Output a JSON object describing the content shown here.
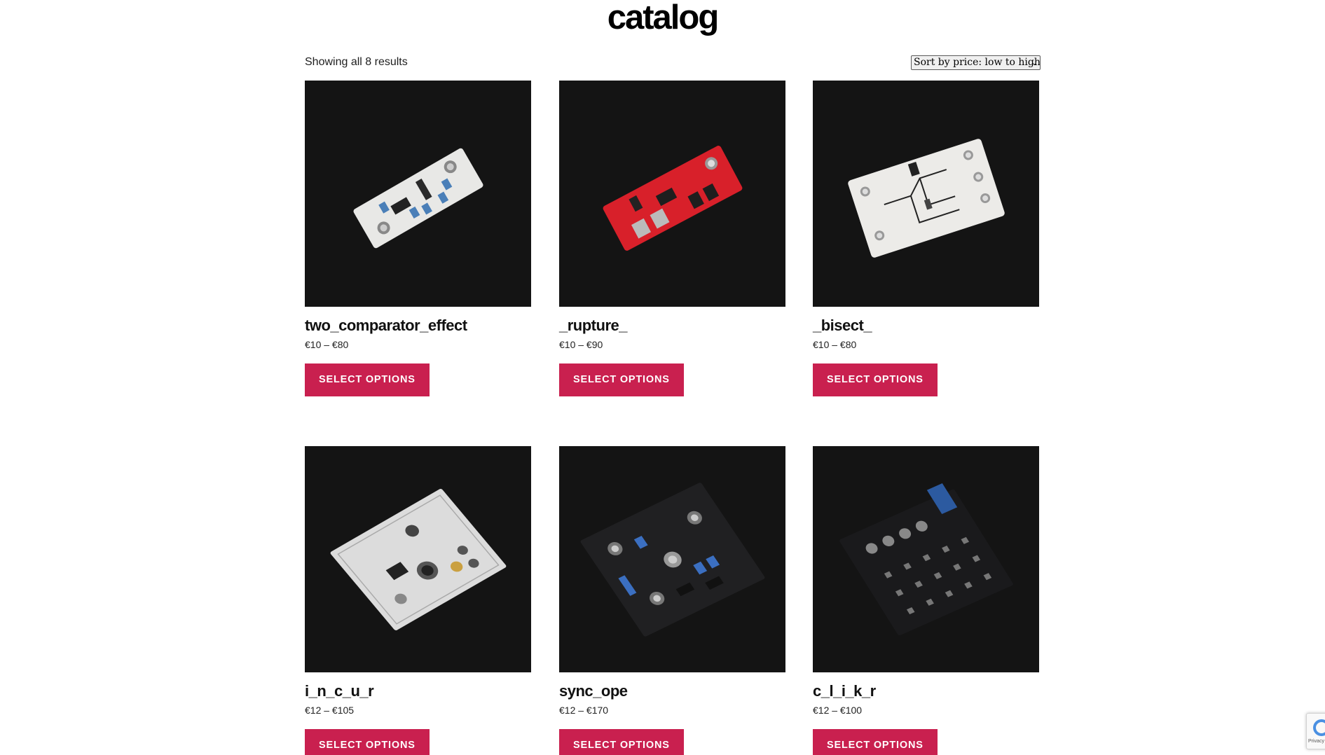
{
  "page": {
    "title": "catalog"
  },
  "results": {
    "count_text": "Showing all 8 results"
  },
  "sort": {
    "selected": "Sort by price: low to high"
  },
  "products": [
    {
      "name": "two_comparator_effect",
      "price": "€10 – €80",
      "button": "Select options",
      "board_color": "#e8e8e6"
    },
    {
      "name": "_rupture_",
      "price": "€10 – €90",
      "button": "Select options",
      "board_color": "#d8202a"
    },
    {
      "name": "_bisect_",
      "price": "€10 – €80",
      "button": "Select options",
      "board_color": "#ecebe8"
    },
    {
      "name": "i_n_c_u_r",
      "price": "€12 – €105",
      "button": "Select options",
      "board_color": "#dcdcdc"
    },
    {
      "name": "sync_ope",
      "price": "€12 – €170",
      "button": "Select options",
      "board_color": "#202022"
    },
    {
      "name": "c_l_i_k_r",
      "price": "€12 – €100",
      "button": "Select options",
      "board_color": "#1a1a1c"
    }
  ],
  "recaptcha": {
    "label": "Privacy"
  },
  "colors": {
    "accent": "#c9204f",
    "image_bg": "#141414"
  }
}
